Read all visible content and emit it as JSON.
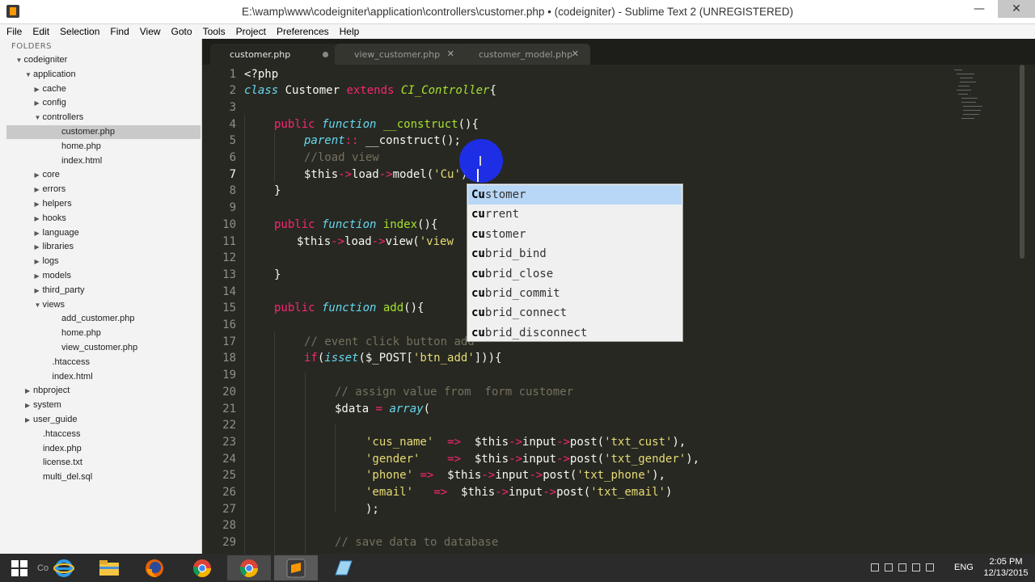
{
  "window": {
    "title": "E:\\wamp\\www\\codeigniter\\application\\controllers\\customer.php • (codeigniter) - Sublime Text 2 (UNREGISTERED)",
    "minimize_glyph": "—",
    "close_glyph": "✕"
  },
  "menu": [
    {
      "label": "File"
    },
    {
      "label": "Edit"
    },
    {
      "label": "Selection"
    },
    {
      "label": "Find"
    },
    {
      "label": "View"
    },
    {
      "label": "Goto"
    },
    {
      "label": "Tools"
    },
    {
      "label": "Project"
    },
    {
      "label": "Preferences"
    },
    {
      "label": "Help"
    }
  ],
  "sidebar": {
    "header": "FOLDERS",
    "items": [
      {
        "label": "codeigniter",
        "arrow": "▼"
      },
      {
        "label": "application",
        "arrow": "▼"
      },
      {
        "label": "cache",
        "arrow": "▶"
      },
      {
        "label": "config",
        "arrow": "▶"
      },
      {
        "label": "controllers",
        "arrow": "▼"
      },
      {
        "label": "customer.php",
        "arrow": ""
      },
      {
        "label": "home.php",
        "arrow": ""
      },
      {
        "label": "index.html",
        "arrow": ""
      },
      {
        "label": "core",
        "arrow": "▶"
      },
      {
        "label": "errors",
        "arrow": "▶"
      },
      {
        "label": "helpers",
        "arrow": "▶"
      },
      {
        "label": "hooks",
        "arrow": "▶"
      },
      {
        "label": "language",
        "arrow": "▶"
      },
      {
        "label": "libraries",
        "arrow": "▶"
      },
      {
        "label": "logs",
        "arrow": "▶"
      },
      {
        "label": "models",
        "arrow": "▶"
      },
      {
        "label": "third_party",
        "arrow": "▶"
      },
      {
        "label": "views",
        "arrow": "▼"
      },
      {
        "label": "add_customer.php",
        "arrow": ""
      },
      {
        "label": "home.php",
        "arrow": ""
      },
      {
        "label": "view_customer.php",
        "arrow": ""
      },
      {
        "label": ".htaccess",
        "arrow": ""
      },
      {
        "label": "index.html",
        "arrow": ""
      },
      {
        "label": "nbproject",
        "arrow": "▶"
      },
      {
        "label": "system",
        "arrow": "▶"
      },
      {
        "label": "user_guide",
        "arrow": "▶"
      },
      {
        "label": ".htaccess",
        "arrow": ""
      },
      {
        "label": "index.php",
        "arrow": ""
      },
      {
        "label": "license.txt",
        "arrow": ""
      },
      {
        "label": "multi_del.sql",
        "arrow": ""
      }
    ]
  },
  "tabs": [
    {
      "label": "customer.php"
    },
    {
      "label": "view_customer.php",
      "close": "✕"
    },
    {
      "label": "customer_model.php",
      "close": "✕"
    }
  ],
  "line_numbers": [
    "1",
    "2",
    "3",
    "4",
    "5",
    "6",
    "7",
    "8",
    "9",
    "10",
    "11",
    "12",
    "13",
    "14",
    "15",
    "16",
    "17",
    "18",
    "19",
    "20",
    "21",
    "22",
    "23",
    "24",
    "25",
    "26",
    "27",
    "28",
    "29"
  ],
  "code": {
    "l1": "<?php",
    "l2_kw": "class",
    "l2_name": " Customer ",
    "l2_ext": "extends",
    "l2_parent": " CI_Controller",
    "l2_brace": "{",
    "l4_pub": "public",
    "l4_fn": " function",
    "l4_name": " __construct",
    "l4_rest": "(){",
    "l5_parent": "parent",
    "l5_op": "::",
    "l5_rest": " __construct();",
    "l6": "//load view",
    "l7_var": "$this",
    "l7_op1": "->",
    "l7_load": "load",
    "l7_op2": "->",
    "l7_model": "model(",
    "l7_str": "'Cu'",
    "l7_end": ")",
    "l8": "}",
    "l10_pub": "public",
    "l10_fn": " function",
    "l10_name": " index",
    "l10_rest": "(){",
    "l11_var": "$this",
    "l11_op1": "->",
    "l11_load": "load",
    "l11_op2": "->",
    "l11_view": "view(",
    "l11_str": "'view",
    "l13": "}",
    "l15_pub": "public",
    "l15_fn": " function",
    "l15_name": " add",
    "l15_rest": "(){",
    "l17_cm1": "// event click button ",
    "l17_cm2": "add",
    "l18_if": "if",
    "l18_a": "(",
    "l18_isset": "isset",
    "l18_b": "($_POST[",
    "l18_str": "'btn_add'",
    "l18_c": "])){",
    "l20": "// assign value from  form customer",
    "l21_var": "$data ",
    "l21_eq": "=",
    "l21_arr": " array",
    "l21_rest": "(",
    "r23": {
      "key": "'cus_name'",
      "pad": "  ",
      "arrow": "=>",
      "gap": "  ",
      "var": "$this",
      "o1": "->",
      "m1": "input",
      "o2": "->",
      "m2": "post(",
      "str": "'txt_cust'",
      "end": "),"
    },
    "r24": {
      "key": "'gender'",
      "pad": "    ",
      "arrow": "=>",
      "gap": "  ",
      "var": "$this",
      "o1": "->",
      "m1": "input",
      "o2": "->",
      "m2": "post(",
      "str": "'txt_gender'",
      "end": "),"
    },
    "r25": {
      "key": "'phone'",
      "pad": " ",
      "arrow": "=>",
      "gap": "  ",
      "var": "$this",
      "o1": "->",
      "m1": "input",
      "o2": "->",
      "m2": "post(",
      "str": "'txt_phone'",
      "end": "),"
    },
    "r26": {
      "key": "'email'",
      "pad": "   ",
      "arrow": "=>",
      "gap": "  ",
      "var": "$this",
      "o1": "->",
      "m1": "input",
      "o2": "->",
      "m2": "post(",
      "str": "'txt_email'",
      "end": ")"
    },
    "l27": ");",
    "l29": "// save data to database"
  },
  "autocomplete": {
    "items": [
      {
        "prefix": "Cu",
        "rest": "stomer"
      },
      {
        "prefix": "cu",
        "rest": "rrent"
      },
      {
        "prefix": "cu",
        "rest": "stomer"
      },
      {
        "prefix": "cu",
        "rest": "brid_bind"
      },
      {
        "prefix": "cu",
        "rest": "brid_close"
      },
      {
        "prefix": "cu",
        "rest": "brid_commit"
      },
      {
        "prefix": "cu",
        "rest": "brid_connect"
      },
      {
        "prefix": "cu",
        "rest": "brid_disconnect"
      }
    ]
  },
  "taskbar": {
    "search_text": "Co",
    "lang": "ENG",
    "time": "2:05 PM",
    "date": "12/13/2015"
  }
}
